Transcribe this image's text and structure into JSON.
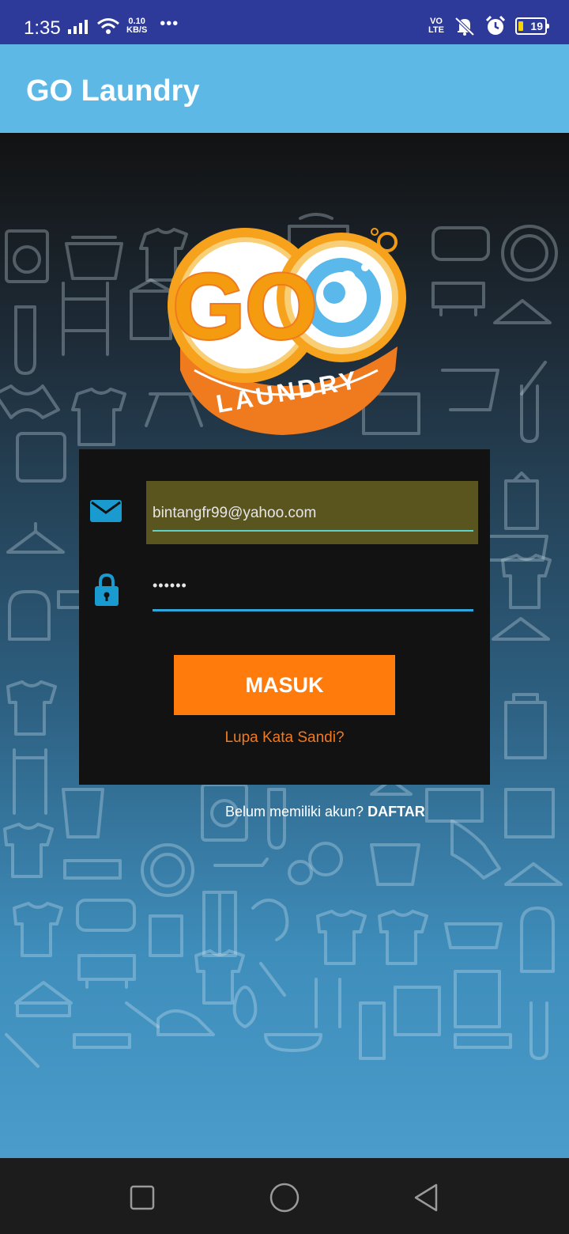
{
  "status_bar": {
    "time": "1:35",
    "net_speed_value": "0.10",
    "net_speed_unit": "KB/S",
    "more": "•••",
    "volte_top": "VO",
    "volte_bottom": "LTE",
    "battery": "19"
  },
  "app_bar": {
    "title": "GO Laundry"
  },
  "logo": {
    "brand_letters": "GO",
    "tagline": "LAUNDRY"
  },
  "login": {
    "email_value": "bintangfr99@yahoo.com",
    "password_mask": "••••••",
    "submit_label": "MASUK",
    "forgot_label": "Lupa Kata Sandi?"
  },
  "register": {
    "prompt": "Belum memiliki akun?",
    "link": "DAFTAR"
  },
  "colors": {
    "status_bar": "#2e3a9a",
    "app_bar": "#5db8e6",
    "accent_orange": "#ff7b0c",
    "email_field_bg": "#5a541e",
    "input_line": "#2fa6d9",
    "icon_blue": "#1a9bd0"
  }
}
